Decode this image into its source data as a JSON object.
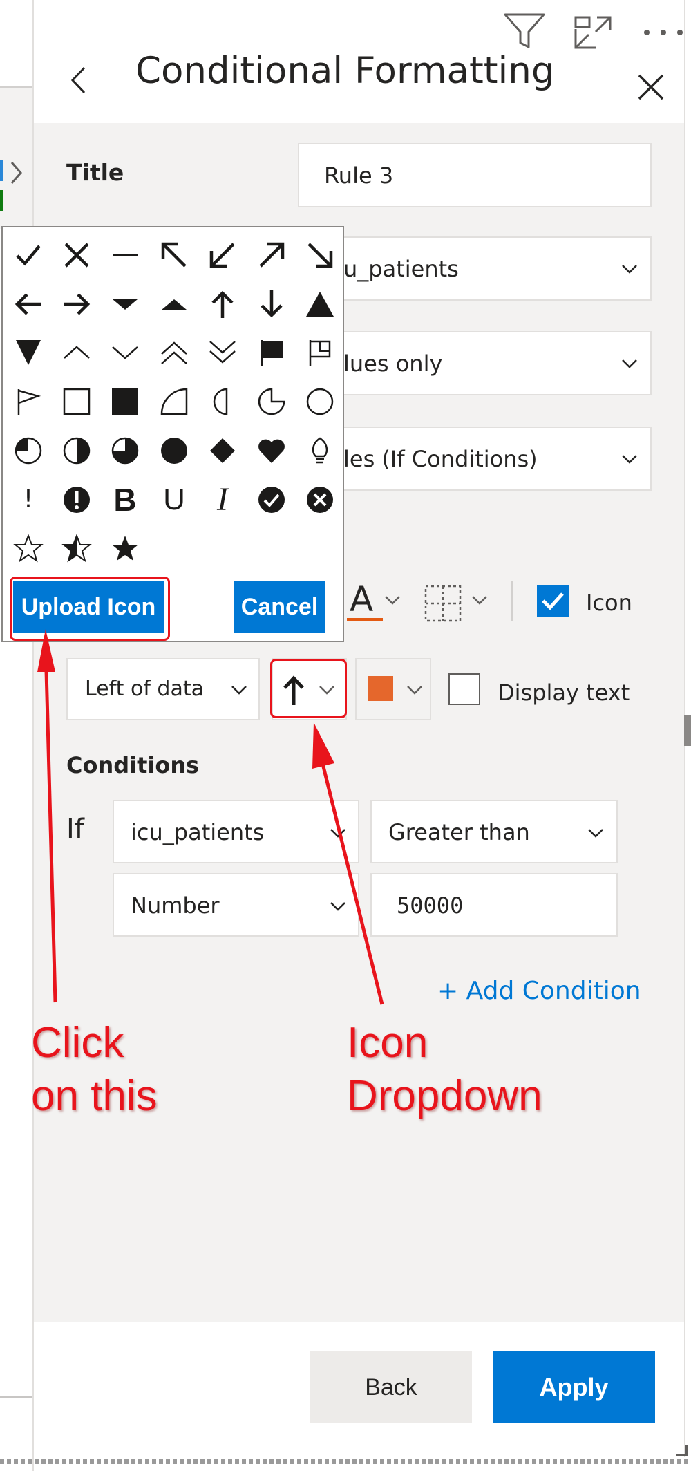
{
  "header": {
    "title": "Conditional Formatting",
    "icons": [
      "filter-icon",
      "focus-mode-icon",
      "more-options-icon",
      "back-chevron-icon",
      "close-icon"
    ]
  },
  "form": {
    "title_label": "Title",
    "title_value": "Rule 3",
    "field_value": "u_patients",
    "apply_to_value": "lues only",
    "format_style_value": "les (If Conditions)"
  },
  "toolbar": {
    "icon_checkbox_checked": true,
    "icon_label": "Icon",
    "font_color_glyph": "A",
    "font_color_underline": "#e35a12"
  },
  "icon_settings": {
    "position_value": "Left of data",
    "selected_icon": "arrow-up-icon",
    "icon_color": "#e5672c",
    "display_text_label": "Display text",
    "display_text_checked": false
  },
  "conditions": {
    "heading": "Conditions",
    "if_label": "If",
    "field_value": "icu_patients",
    "operator_value": "Greater than",
    "type_value": "Number",
    "value": "50000",
    "add_condition_label": "+ Add Condition"
  },
  "footer": {
    "back_label": "Back",
    "apply_label": "Apply"
  },
  "icon_picker": {
    "icons": [
      "check-icon",
      "x-icon",
      "dash-icon",
      "arrow-up-left-icon",
      "arrow-down-left-icon",
      "arrow-up-right-icon",
      "arrow-down-right-icon",
      "arrow-left-icon",
      "arrow-right-icon",
      "triangle-down-small-icon",
      "triangle-up-small-icon",
      "arrow-up-icon",
      "arrow-down-icon",
      "triangle-up-icon",
      "triangle-down-icon",
      "chevron-up-icon",
      "chevron-down-icon",
      "double-chevron-up-icon",
      "double-chevron-down-icon",
      "flag-filled-icon",
      "flag-outline-icon",
      "flag-small-icon",
      "square-outline-icon",
      "square-filled-icon",
      "quarter-circle-icon",
      "half-moon-icon",
      "three-quarter-circle-icon",
      "circle-outline-icon",
      "pie-quarter-icon",
      "circle-half-icon",
      "pie-three-quarter-icon",
      "circle-filled-icon",
      "diamond-icon",
      "heart-icon",
      "lightbulb-icon",
      "exclamation-icon",
      "exclamation-circle-icon",
      "bold-icon",
      "underline-icon",
      "italic-icon",
      "check-circle-icon",
      "x-circle-icon",
      "star-outline-icon",
      "star-half-icon",
      "star-filled-icon"
    ],
    "glyph_bold": "B",
    "glyph_underline": "U",
    "glyph_italic": "I",
    "glyph_exclamation": "!",
    "upload_label": "Upload Icon",
    "cancel_label": "Cancel"
  },
  "annotations": {
    "left_line1": "Click",
    "left_line2": "on this",
    "right_line1": "Icon",
    "right_line2": "Dropdown",
    "color": "#e8141c"
  },
  "colors": {
    "accent": "#0078d4",
    "panel_bg": "#f3f2f1",
    "text": "#252423",
    "link": "#0078d4"
  }
}
